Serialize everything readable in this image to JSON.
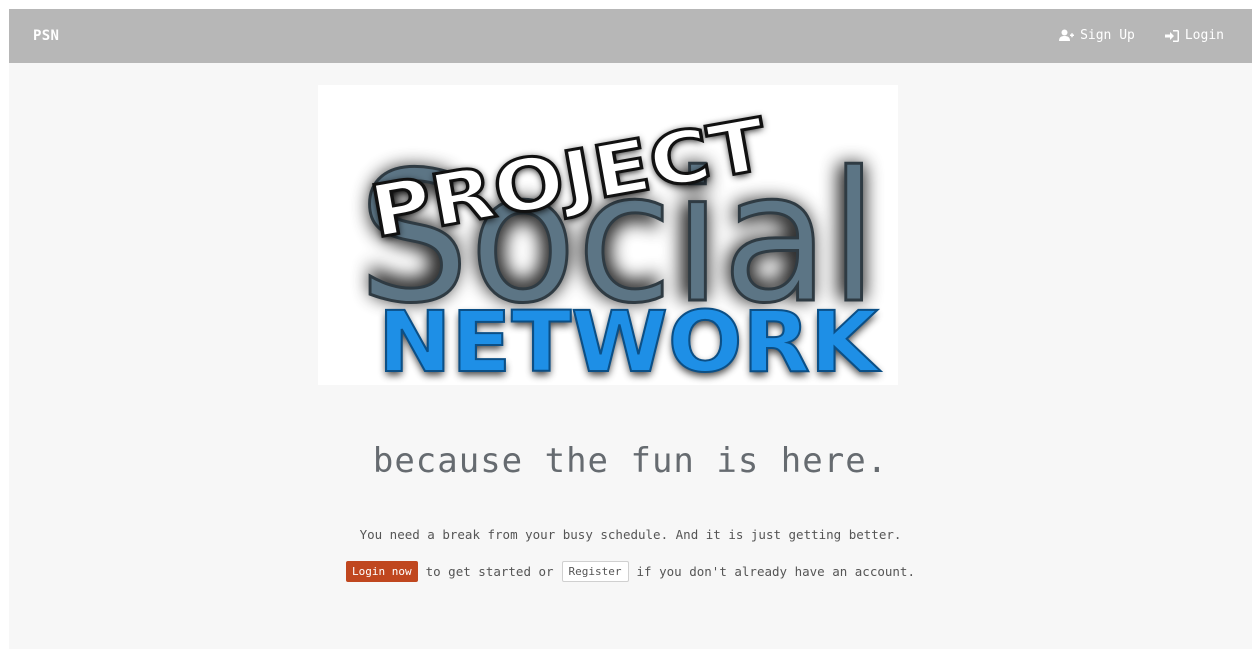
{
  "navbar": {
    "brand": "PSN",
    "signup_label": "Sign Up",
    "login_label": "Login",
    "icons": {
      "signup": "user-plus-icon",
      "login": "sign-in-icon"
    }
  },
  "logo": {
    "line1": "PROJECT",
    "line2": "Social",
    "line3": "NETWORK"
  },
  "hero": {
    "tagline": "because the fun is here.",
    "lead": "You need a break from your busy schedule. And it is just getting better.",
    "login_button": "Login now",
    "middle_text": "to get started or",
    "register_button": "Register",
    "trailing_text": "if you don't already have an account."
  },
  "colors": {
    "navbar_bg": "#b7b7b7",
    "page_bg": "#f7f7f7",
    "login_btn": "#c0471f",
    "network_blue": "#1e8fe6",
    "social_slate": "#5c7585"
  }
}
